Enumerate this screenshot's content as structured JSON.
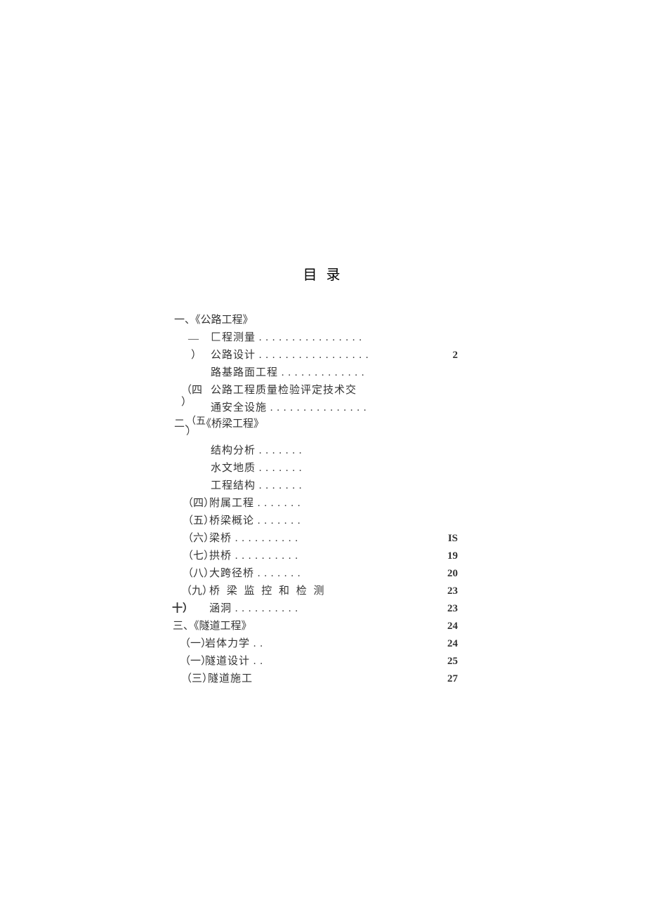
{
  "title": "目 录",
  "toc": {
    "sec1": "一、《公路工程》",
    "s1_m1": "—",
    "s1_l1": "匚程测量 . . . . . . . . . . . . . . . .",
    "s1_m2": "）",
    "s1_l2": "公路设计 . . . . . . . . . . . . . . . . .",
    "s1_p2": "2",
    "s1_l3": "路基路面工程 . . . . . . . . . . . . .",
    "s1_m4a": "（四",
    "s1_m4b": "）",
    "s1_l4a": "公路工程质量检验评定技术交",
    "s1_l4b": "通安全设施 . . . . . . . . . . . . . . .",
    "float2": "二、",
    "s1_m5": "（五",
    "s1_m5b": "）",
    "sec2": "《桥梁工程》",
    "s2_l1": "结构分析 . . . . . . .",
    "s2_l2": "水文地质 . . . . . . .",
    "s2_l3": "工程结构 . . . . . . .",
    "s2_m4": "（四）",
    "s2_l4": "附属工程 . . . . . . .",
    "s2_m5": "（五）",
    "s2_l5": "桥梁概论 . . . . . . .",
    "s2_m6": "（六）",
    "s2_l6": "梁桥 . . . . . . . . . .",
    "s2_p6": "IS",
    "s2_m7": "（七）",
    "s2_l7": "拱桥 . . . . . . . . . .",
    "s2_p7": "19",
    "s2_m8": "（八）",
    "s2_l8": "大跨径桥 . . . . . . .",
    "s2_p8": "20",
    "s2_m9": "（九）",
    "s2_l9": "桥 梁 监 控 和 检 测",
    "s2_p9": "23",
    "s2_m10": "十）",
    "s2_l10": "涵洞 . . . . . . . . . .",
    "s2_p10": "23",
    "sec3": "三、《隧道工程》",
    "s3_p0": "24",
    "s3_m1": "（一）",
    "s3_l1": "岩体力学 . .",
    "s3_p1": "24",
    "s3_m2": "（一）",
    "s3_l2": "隧道设计 . .",
    "s3_p2": "25",
    "s3_m3": "（三）",
    "s3_l3": "隧道施工",
    "s3_p3": "27"
  }
}
